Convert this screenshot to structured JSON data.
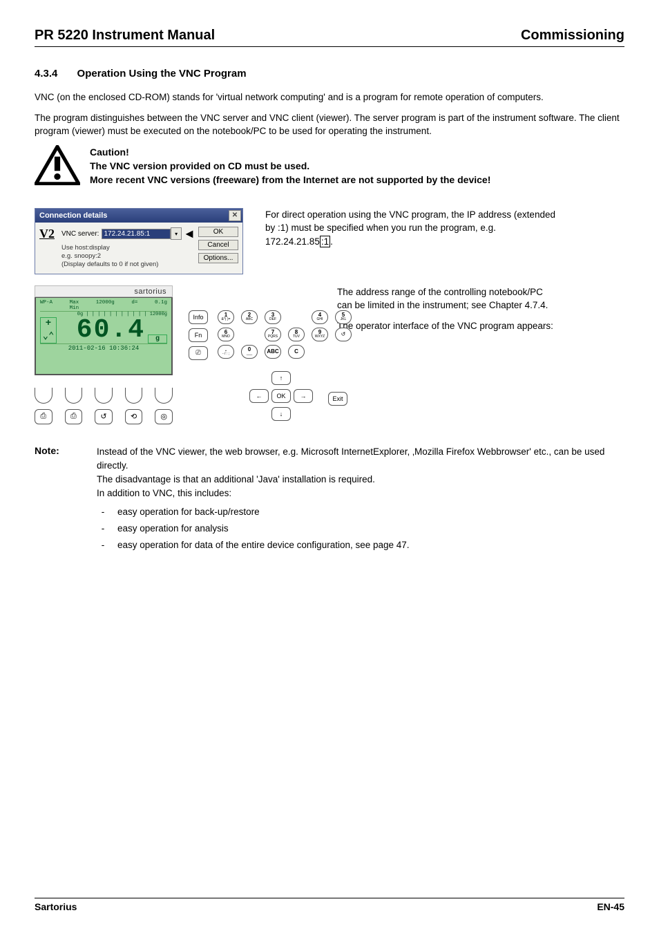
{
  "header": {
    "left": "PR 5220 Instrument Manual",
    "right": "Commissioning"
  },
  "section": {
    "number": "4.3.4",
    "title": "Operation Using the VNC Program"
  },
  "para1": "VNC (on the enclosed CD-ROM) stands for 'virtual network computing' and is a program for remote operation of computers.",
  "para2": "The program distinguishes between the VNC server and VNC client (viewer). The server program is part of the instrument software. The client program (viewer) must be executed on the notebook/PC to be used for operating the instrument.",
  "caution": {
    "title": "Caution!",
    "line1": "The VNC version provided on CD must be used.",
    "line2": "More recent VNC versions (freeware) from the Internet are not supported by the device!"
  },
  "dialog": {
    "title": "Connection details",
    "close": "✕",
    "logo": "V2",
    "server_label": "VNC server:",
    "server_value": "172.24.21.85:1",
    "hint1": "Use host:display",
    "hint2": "e.g. snoopy:2",
    "hint3": "(Display defaults to 0 if not given)",
    "btn_ok": "OK",
    "btn_cancel": "Cancel",
    "btn_options": "Options..."
  },
  "dlg_side": {
    "pre": "For direct operation using the VNC program, the IP address (extended by :1) must be specified when you run the program, e.g. 172.24.21.85",
    "suffix": ":1",
    "post": "."
  },
  "device": {
    "brand": "sartorius",
    "lcd": {
      "wp": "WP-A",
      "max": "Max",
      "min": "Min",
      "cap": "12000g",
      "d": "d=",
      "step": "0.1g",
      "range_end": "12000g",
      "big": "60.4",
      "unit": "g",
      "date": "2011-02-16  10:36:24",
      "plus": "+",
      "tilde": "⌄⌃"
    },
    "left_keys": {
      "info": "Info",
      "fn": "Fn",
      "lang": "⎚"
    },
    "keypad": [
      [
        "1",
        "2",
        "3",
        ""
      ],
      [
        "4",
        "5",
        "6",
        ""
      ],
      [
        "7",
        "8",
        "9",
        "↺"
      ],
      [
        ".",
        "0",
        "ABC",
        "C"
      ]
    ],
    "keypad_sub": [
      [
        "&*( )=",
        "ABC",
        "DEF",
        ""
      ],
      [
        "GHI",
        "JKL",
        "MNO",
        ""
      ],
      [
        "PQRS",
        "TUV",
        "WXYZ",
        ""
      ],
      [
        "- / : ;",
        "___",
        "",
        ""
      ]
    ],
    "bottom_icons": [
      "⎙",
      "⎙",
      "↺",
      "⟲",
      "◎"
    ],
    "nav": {
      "up": "↑",
      "down": "↓",
      "left": "←",
      "right": "→",
      "ok": "OK"
    },
    "exit": "Exit"
  },
  "device_side": {
    "p1": "The address range of the controlling notebook/PC can be limited in the instrument; see Chapter 4.7.4.",
    "p2": "The operator interface of the VNC program appears:"
  },
  "note": {
    "label": "Note:",
    "p1": "Instead of the VNC viewer, the web browser, e.g. Microsoft InternetExplorer, ‚Mozilla Firefox Webbrowser' etc., can be used directly.",
    "p2": "The disadvantage is that an additional 'Java' installation is required.",
    "p3": "In addition to VNC, this includes:",
    "items": [
      "easy operation for back-up/restore",
      "easy operation for analysis",
      "easy operation for data of the entire device configuration, see page 47."
    ]
  },
  "footer": {
    "left": "Sartorius",
    "right": "EN-45"
  }
}
